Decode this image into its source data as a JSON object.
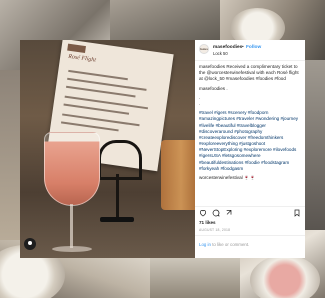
{
  "profile": {
    "avatar_text": "locus",
    "username": "masefoodies",
    "separator": "•",
    "follow_label": "Follow",
    "location": "Lock 50"
  },
  "caption": {
    "intro": "masefoodies Received a complimentary ticket to the @worcesterwinefestival with each Rosé flight at @lock_50 #masefoodies #foodies #food",
    "signature": "masefoodies .",
    "dots": ".\n.",
    "hashtags": "#travel #igers #scenery #foodporn #amazingpictures #traveler #wondering #journey #livelife #beautiful #travelblogger #discoveraround #photography #createexplorediscover #freedomthinkers #exploreeverything #justgoshoot #NeverStopExploring #exploremore #ilovefoods #igersUSA #letsgosomewhere #beautifuldestinations #foodie #foodstagram #forkyeah #foodgasm",
    "closing": "worcesterwinefestival 🍷🍷"
  },
  "post": {
    "likes": "71 likes",
    "date": "AUGUST 18, 2018"
  },
  "login": {
    "link": "Log in",
    "rest": " to like or comment."
  },
  "photo": {
    "menu_title": "Rosé Flight"
  },
  "icons": [
    "heart-icon",
    "comment-icon",
    "share-icon",
    "bookmark-icon",
    "tag-user-icon"
  ],
  "colors": {
    "link": "#3897f0",
    "hashtag": "#003569",
    "text": "#262626"
  }
}
